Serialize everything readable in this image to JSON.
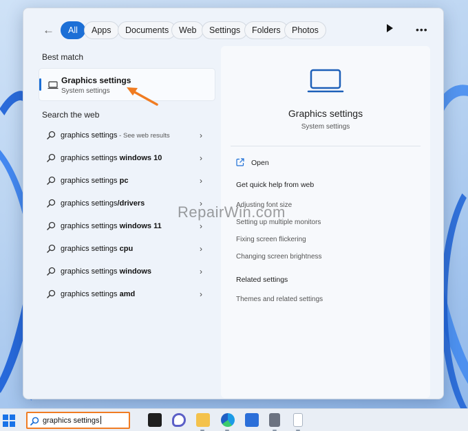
{
  "tabs": [
    {
      "label": "All",
      "active": true
    },
    {
      "label": "Apps"
    },
    {
      "label": "Documents"
    },
    {
      "label": "Web"
    },
    {
      "label": "Settings"
    },
    {
      "label": "Folders"
    },
    {
      "label": "Photos"
    }
  ],
  "more_label": "•••",
  "best_match": {
    "heading": "Best match",
    "title": "Graphics settings",
    "subtitle": "System settings"
  },
  "web": {
    "heading": "Search the web",
    "items": [
      {
        "prefix": "graphics settings",
        "bold": "",
        "suffix": " - See web results"
      },
      {
        "prefix": "graphics settings ",
        "bold": "windows 10",
        "suffix": ""
      },
      {
        "prefix": "graphics settings ",
        "bold": "pc",
        "suffix": ""
      },
      {
        "prefix": "graphics settings",
        "bold": "/drivers",
        "suffix": ""
      },
      {
        "prefix": "graphics settings ",
        "bold": "windows 11",
        "suffix": ""
      },
      {
        "prefix": "graphics settings ",
        "bold": "cpu",
        "suffix": ""
      },
      {
        "prefix": "graphics settings ",
        "bold": "windows",
        "suffix": ""
      },
      {
        "prefix": "graphics settings ",
        "bold": "amd",
        "suffix": ""
      }
    ]
  },
  "detail": {
    "title": "Graphics settings",
    "subtitle": "System settings",
    "open_label": "Open",
    "quick_help_heading": "Get quick help from web",
    "quick_help_links": [
      "Adjusting font size",
      "Setting up multiple monitors",
      "Fixing screen flickering",
      "Changing screen brightness"
    ],
    "related_heading": "Related settings",
    "related_links": [
      "Themes and related settings"
    ]
  },
  "watermark": "RepairWin.com",
  "taskbar": {
    "search_query": "graphics settings"
  },
  "colors": {
    "accent": "#1c6fd6",
    "annotation_arrow": "#f07c22",
    "search_highlight_border": "#f07c22"
  }
}
